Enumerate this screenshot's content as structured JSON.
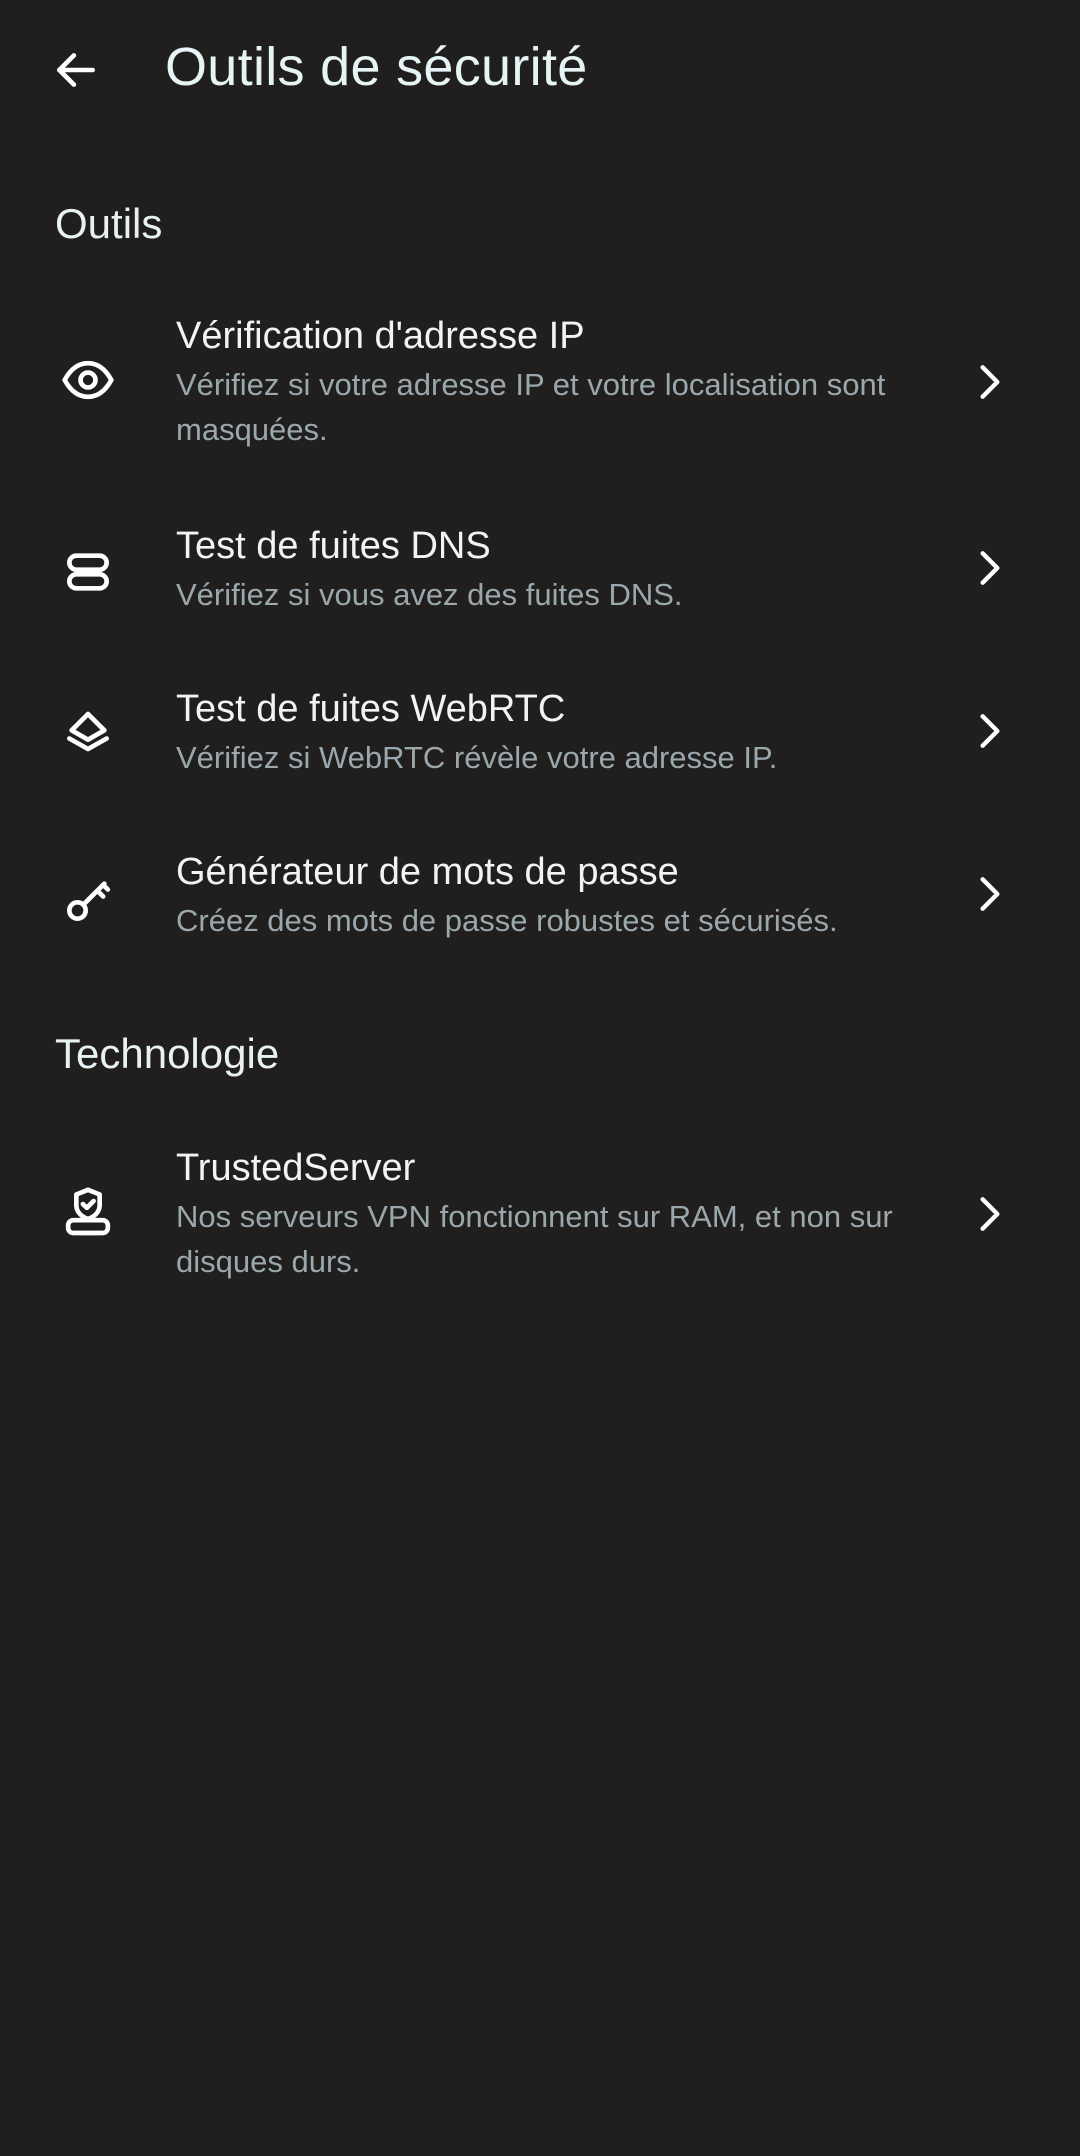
{
  "header": {
    "title": "Outils de sécurité",
    "back_icon": "arrow-left-icon"
  },
  "sections": [
    {
      "label": "Outils",
      "items": [
        {
          "title": "Vérification d'adresse IP",
          "subtitle": "Vérifiez si votre adresse IP et votre localisation sont masquées.",
          "icon": "eye-icon"
        },
        {
          "title": "Test de fuites DNS",
          "subtitle": "Vérifiez si vous avez des fuites DNS.",
          "icon": "server-icon"
        },
        {
          "title": "Test de fuites WebRTC",
          "subtitle": "Vérifiez si WebRTC révèle votre adresse IP.",
          "icon": "layers-icon"
        },
        {
          "title": "Générateur de mots de passe",
          "subtitle": "Créez des mots de passe robustes et sécurisés.",
          "icon": "key-icon"
        }
      ]
    },
    {
      "label": "Technologie",
      "items": [
        {
          "title": "TrustedServer",
          "subtitle": "Nos serveurs VPN fonctionnent sur RAM, et non sur disques durs.",
          "icon": "shield-server-icon"
        }
      ]
    }
  ],
  "colors": {
    "background": "#201f1d",
    "title_text": "#e6f4f6",
    "item_title": "#f2f4f4",
    "item_subtitle": "#9aa7ad",
    "icon": "#ffffff"
  }
}
